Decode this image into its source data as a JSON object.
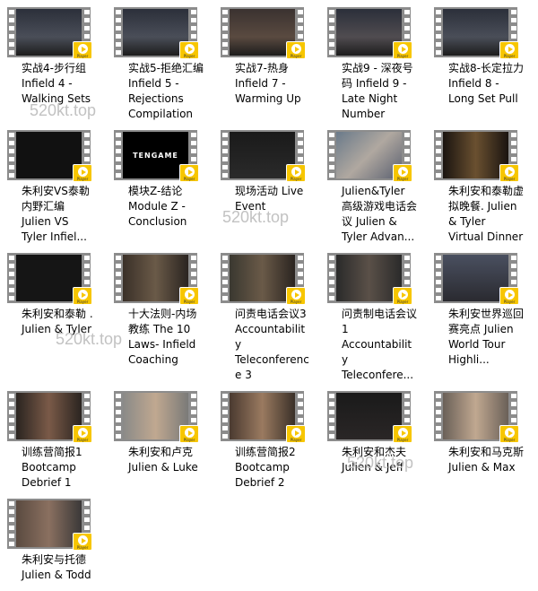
{
  "badge_label": "Player",
  "badge_color": "#f7c600",
  "watermark": "520kt.top",
  "items": [
    {
      "label": "实战4-步行组 Infield 4 - Walking Sets",
      "bg": "linear-gradient(#2b2f3a,#4a4e58 60%,#1c1c1c)"
    },
    {
      "label": "实战5-拒绝汇编 Infield 5 - Rejections Compilation",
      "bg": "linear-gradient(#2b2f3a,#4a4e58 60%,#1c1c1c)"
    },
    {
      "label": "实战7-热身 Infield 7 - Warming Up",
      "bg": "linear-gradient(#3a3230,#5a4a40 60%,#1c1c1c)"
    },
    {
      "label": "实战9 - 深夜号码 Infield 9 - Late Night Number",
      "bg": "linear-gradient(#2b2f3a,#504c50 60%,#1c1c1c)"
    },
    {
      "label": "实战8-长定拉力 Infield 8 - Long Set Pull",
      "bg": "linear-gradient(#2b2f3a,#4a4e58 60%,#1c1c1c)"
    },
    {
      "label": "朱利安VS泰勒内野汇编 Julien VS Tyler Infiel...",
      "bg": "#111"
    },
    {
      "label": "模块Z-结论 Module Z - Conclusion",
      "bg": "#000",
      "logo": "TENGAME"
    },
    {
      "label": "现场活动 Live Event",
      "bg": "linear-gradient(#1a1a1a,#2a2a2a)"
    },
    {
      "label": "Julien&Tyler 高级游戏电话会议  Julien & Tyler Advan...",
      "bg": "linear-gradient(135deg,#6a7a8a,#b0a8a0,#5a6070)"
    },
    {
      "label": "朱利安和泰勒虚拟晚餐. Julien & Tyler Virtual Dinner",
      "bg": "linear-gradient(90deg,#1a1410,#6a5030 50%,#1a1410)"
    },
    {
      "label": "朱利安和泰勒 . Julien & Tyler",
      "bg": "#151515"
    },
    {
      "label": "十大法则-内场教练 The 10 Laws- Infield Coaching",
      "bg": "linear-gradient(90deg,#3a3028,#6a5a48,#2a2420)"
    },
    {
      "label": "问责电话会议3 Accountability Teleconference 3",
      "bg": "linear-gradient(90deg,#3a3830,#6a5a48,#2a2420)"
    },
    {
      "label": "问责制电话会议1 Accountability Teleconfere...",
      "bg": "linear-gradient(90deg,#2a2a2a,#5a5048,#2a2a2a)"
    },
    {
      "label": "朱利安世界巡回赛亮点 Julien World Tour Highli...",
      "bg": "linear-gradient(#4a5060,#2a2a30)"
    },
    {
      "label": "训练营简报1 Bootcamp Debrief 1",
      "bg": "linear-gradient(90deg,#2a2420,#7a5a48,#2a2420)"
    },
    {
      "label": "朱利安和卢克 Julien & Luke",
      "bg": "linear-gradient(90deg,#8a8a88,#c0a890,#7a7a78)"
    },
    {
      "label": "训练营简报2 Bootcamp Debrief 2",
      "bg": "linear-gradient(90deg,#4a3a30,#9a7a60,#3a3028)"
    },
    {
      "label": "朱利安和杰夫 Julien & Jeff",
      "bg": "linear-gradient(#1a1a1a,#2a2626)"
    },
    {
      "label": "朱利安和马克斯 Julien & Max",
      "bg": "linear-gradient(90deg,#6a6058,#c0a890,#6a6058)"
    },
    {
      "label": "朱利安与托德 Julien & Todd",
      "bg": "linear-gradient(90deg,#5a4a40,#8a7060,#3a3838)"
    }
  ]
}
